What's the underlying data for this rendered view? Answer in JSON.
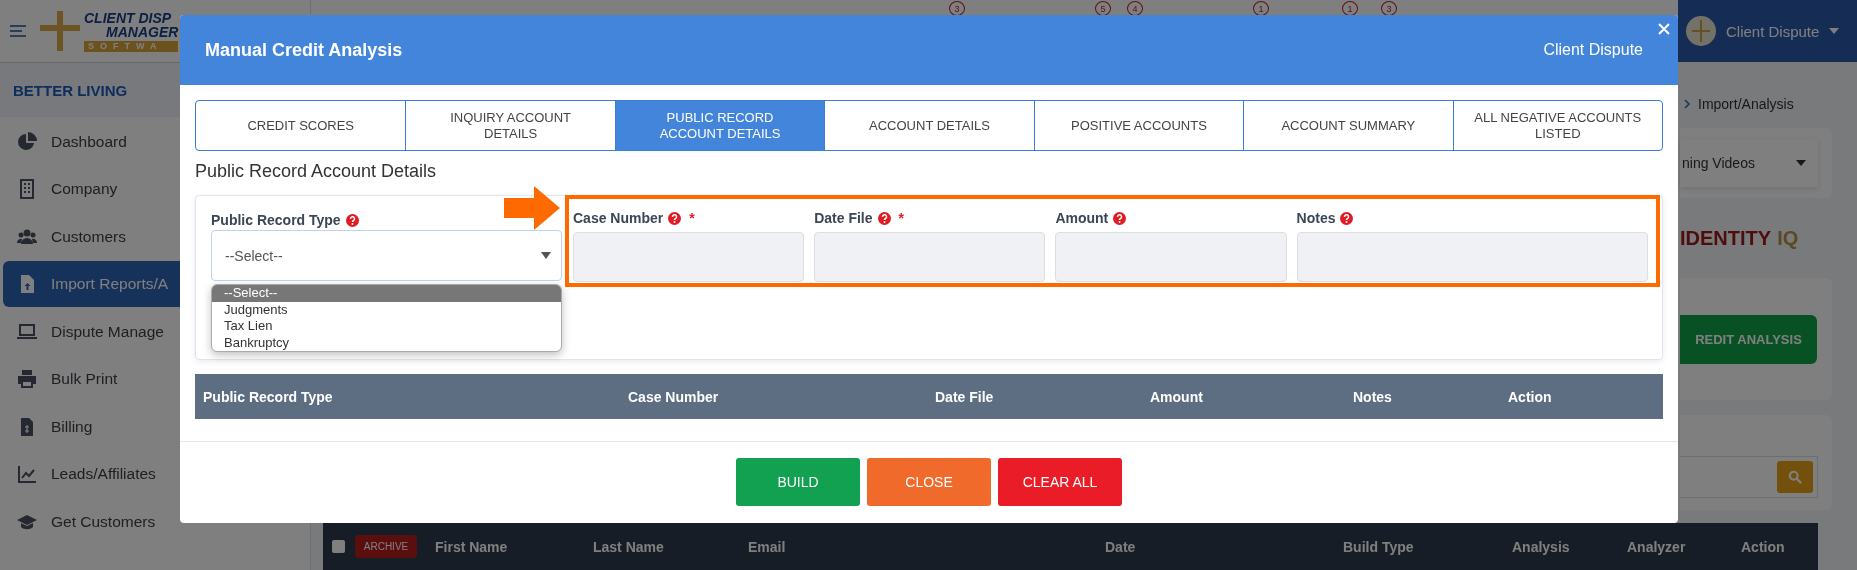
{
  "sidebar": {
    "logo": [
      "CLIENT DISP",
      "MANAGER",
      "SOFTWA"
    ],
    "org": "BETTER LIVING",
    "items": [
      {
        "label": "Dashboard",
        "selected": false
      },
      {
        "label": "Company",
        "selected": false
      },
      {
        "label": "Customers",
        "selected": false
      },
      {
        "label": "Import Reports/A",
        "selected": true
      },
      {
        "label": "Dispute Manage",
        "selected": false
      },
      {
        "label": "Bulk Print",
        "selected": false
      },
      {
        "label": "Billing",
        "selected": false
      },
      {
        "label": "Leads/Affiliates",
        "selected": false
      },
      {
        "label": "Get Customers",
        "selected": false
      }
    ]
  },
  "header": {
    "badges": [
      "3",
      "5",
      "4",
      "1",
      "1",
      "3"
    ],
    "user": "Client Dispute"
  },
  "page": {
    "breadcrumb": "Import/Analysis",
    "videos_select": "ning Videos",
    "brand": [
      "IDENTITY",
      "IQ"
    ],
    "action_button": "REDIT ANALYSIS"
  },
  "list_header": {
    "select_all": {
      "checked": false
    },
    "archive_button": "ARCHIVE",
    "columns": [
      "First Name",
      "Last Name",
      "Email",
      "Date",
      "Build Type",
      "Analysis",
      "Analyzer",
      "Action"
    ]
  },
  "modal": {
    "title": "Manual Credit Analysis",
    "subtitle": "Client Dispute",
    "tabs": [
      {
        "label": "CREDIT SCORES",
        "selected": false
      },
      {
        "label": "INQUIRY ACCOUNT DETAILS",
        "selected": false
      },
      {
        "label": "PUBLIC RECORD ACCOUNT DETAILS",
        "selected": true
      },
      {
        "label": "ACCOUNT DETAILS",
        "selected": false
      },
      {
        "label": "POSITIVE ACCOUNTS",
        "selected": false
      },
      {
        "label": "ACCOUNT SUMMARY",
        "selected": false
      },
      {
        "label": "ALL NEGATIVE ACCOUNTS LISTED",
        "selected": false
      }
    ],
    "section_title": "Public Record Account Details",
    "type_select": {
      "label": "Public Record Type",
      "help": true,
      "value": "--Select--",
      "open": true,
      "options": [
        {
          "label": "--Select--",
          "selected": true
        },
        {
          "label": "Judgments",
          "selected": false
        },
        {
          "label": "Tax Lien",
          "selected": false
        },
        {
          "label": "Bankruptcy",
          "selected": false
        }
      ]
    },
    "fields": [
      {
        "label": "Case Number",
        "help": true,
        "required_mark": "*"
      },
      {
        "label": "Date File",
        "help": true,
        "required_mark": "*"
      },
      {
        "label": "Amount",
        "help": true
      },
      {
        "label": "Notes",
        "help": true
      }
    ],
    "table_columns": [
      "Public Record Type",
      "Case Number",
      "Date File",
      "Amount",
      "Notes",
      "Action"
    ],
    "buttons": [
      {
        "label": "BUILD",
        "kind": "primary"
      },
      {
        "label": "CLOSE",
        "kind": "warning"
      },
      {
        "label": "CLEAR ALL",
        "kind": "danger"
      }
    ]
  }
}
